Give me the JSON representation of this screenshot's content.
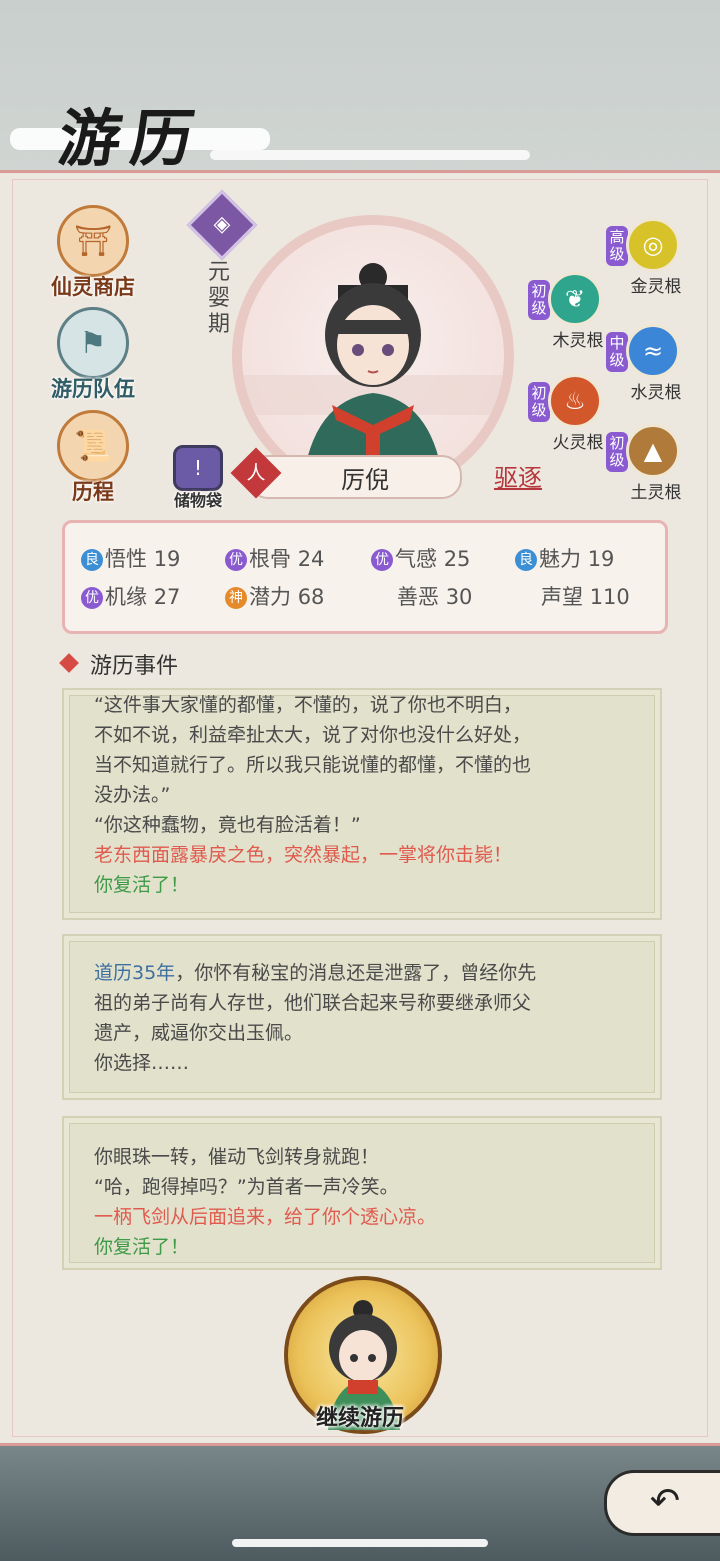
{
  "header": {
    "title": "游历"
  },
  "left_menu": [
    {
      "label": "仙灵商店",
      "icon": "shop-gate-icon"
    },
    {
      "label": "游历队伍",
      "icon": "team-flag-icon"
    },
    {
      "label": "历程",
      "icon": "scroll-icon"
    }
  ],
  "character": {
    "realm": "元婴期",
    "race": "人",
    "name": "厉倪",
    "expel_label": "驱逐",
    "bag_label": "储物袋",
    "bag_badge": "!"
  },
  "spirit_roots": [
    {
      "grade": "高级",
      "name": "金灵根",
      "color": "#d8c22a"
    },
    {
      "grade": "初级",
      "name": "木灵根",
      "color": "#2fa58e"
    },
    {
      "grade": "中级",
      "name": "水灵根",
      "color": "#3b86d6"
    },
    {
      "grade": "初级",
      "name": "火灵根",
      "color": "#d2582c"
    },
    {
      "grade": "初级",
      "name": "土灵根",
      "color": "#b07a3a"
    }
  ],
  "stats": [
    {
      "grade": "良",
      "grade_color": "#3c8fd4",
      "label": "悟性",
      "value": "19"
    },
    {
      "grade": "优",
      "grade_color": "#8a5bd0",
      "label": "根骨",
      "value": "24"
    },
    {
      "grade": "优",
      "grade_color": "#8a5bd0",
      "label": "气感",
      "value": "25"
    },
    {
      "grade": "良",
      "grade_color": "#3c8fd4",
      "label": "魅力",
      "value": "19"
    },
    {
      "grade": "优",
      "grade_color": "#8a5bd0",
      "label": "机缘",
      "value": "27"
    },
    {
      "grade": "神",
      "grade_color": "#e58a2a",
      "label": "潜力",
      "value": "68"
    },
    {
      "grade": "",
      "grade_color": "",
      "label": "善恶",
      "value": "30"
    },
    {
      "grade": "",
      "grade_color": "",
      "label": "声望",
      "value": "110"
    }
  ],
  "events": {
    "title": "游历事件",
    "cards": [
      {
        "lines": [
          {
            "text": "“这件事大家懂的都懂，不懂的，说了你也不明白，",
            "style": "normal"
          },
          {
            "text": "不如不说，利益牵扯太大，说了对你也没什么好处，",
            "style": "normal"
          },
          {
            "text": "当不知道就行了。所以我只能说懂的都懂，不懂的也",
            "style": "normal"
          },
          {
            "text": "没办法。”",
            "style": "normal"
          },
          {
            "text": "“你这种蠢物，竟也有脸活着！”",
            "style": "normal"
          },
          {
            "text": "老东西面露暴戾之色，突然暴起，一掌将你击毙！",
            "style": "red"
          },
          {
            "text": "你复活了！",
            "style": "green"
          }
        ]
      },
      {
        "lines": [
          {
            "prefix": "道历35年",
            "text": "，你怀有秘宝的消息还是泄露了，曾经你先",
            "style": "normal"
          },
          {
            "text": "祖的弟子尚有人存世，他们联合起来号称要继承师父",
            "style": "normal"
          },
          {
            "text": "遗产，威逼你交出玉佩。",
            "style": "normal"
          },
          {
            "text": "你选择……",
            "style": "normal"
          }
        ]
      },
      {
        "lines": [
          {
            "text": "你眼珠一转，催动飞剑转身就跑！",
            "style": "normal"
          },
          {
            "text": "“哈，跑得掉吗？”为首者一声冷笑。",
            "style": "normal"
          },
          {
            "text": "一柄飞剑从后面追来，给了你个透心凉。",
            "style": "red"
          },
          {
            "text": "你复活了！",
            "style": "green"
          }
        ]
      }
    ]
  },
  "continue_button": {
    "label": "继续游历"
  },
  "back_button": {
    "icon": "back-arrow-icon",
    "glyph": "↶"
  }
}
